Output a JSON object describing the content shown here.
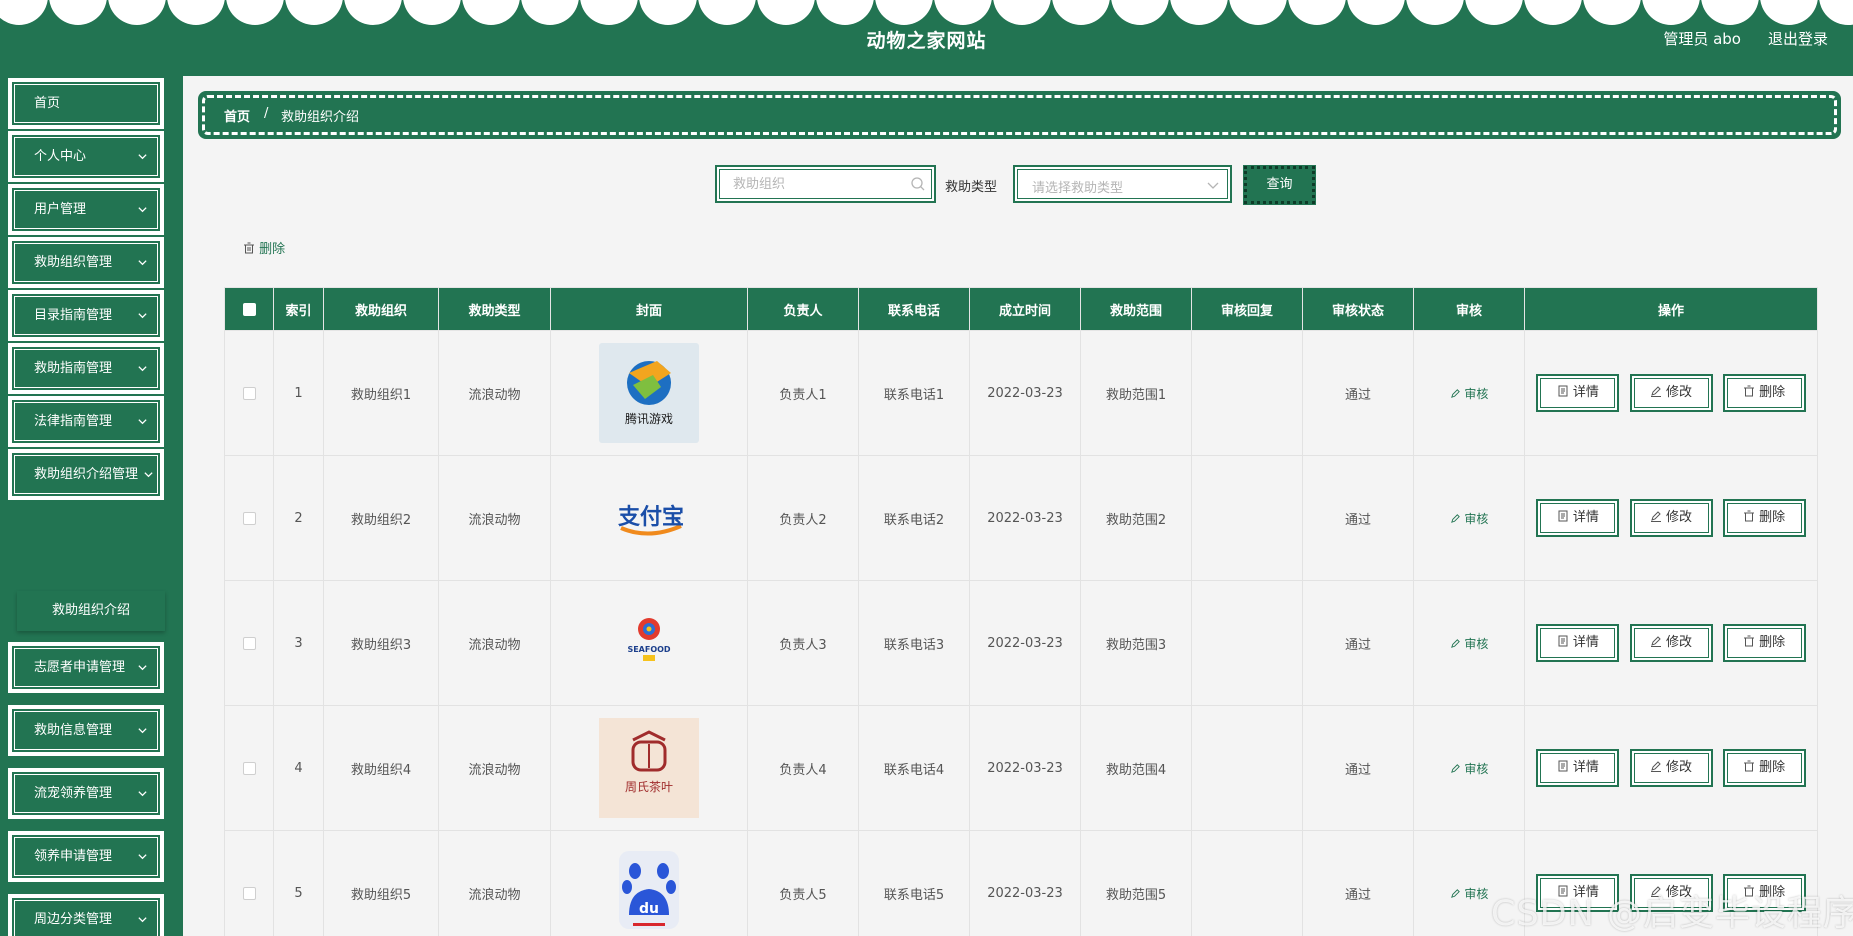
{
  "header": {
    "title": "动物之家网站",
    "user": "管理员 abo",
    "logout": "退出登录"
  },
  "colors": {
    "primary": "#227452",
    "background": "#f4f4f4",
    "link": "#227452"
  },
  "sidebar": {
    "items": [
      {
        "label": "首页"
      },
      {
        "label": "个人中心"
      },
      {
        "label": "用户管理"
      },
      {
        "label": "救助组织管理"
      },
      {
        "label": "目录指南管理"
      },
      {
        "label": "救助指南管理"
      },
      {
        "label": "法律指南管理"
      },
      {
        "label": "救助组织介绍管理"
      },
      {
        "label": "志愿者申请管理"
      },
      {
        "label": "救助信息管理"
      },
      {
        "label": "流宠领养管理"
      },
      {
        "label": "领养申请管理"
      },
      {
        "label": "周边分类管理"
      }
    ],
    "submenu_item": "救助组织介绍"
  },
  "breadcrumb": {
    "home": "首页",
    "separator": "/",
    "current": "救助组织介绍"
  },
  "search": {
    "org_placeholder": "救助组织",
    "type_label": "救助类型",
    "type_placeholder": "请选择救助类型",
    "query_button": "查询"
  },
  "toolbar": {
    "delete_label": "删除"
  },
  "table": {
    "headers": [
      "索引",
      "救助组织",
      "救助类型",
      "封面",
      "负责人",
      "联系电话",
      "成立时间",
      "救助范围",
      "审核回复",
      "审核状态",
      "审核",
      "操作"
    ],
    "audit_label": "审核",
    "actions": {
      "detail": "详情",
      "edit": "修改",
      "delete": "删除"
    },
    "rows": [
      {
        "index": "1",
        "org": "救助组织1",
        "type": "流浪动物",
        "cover_icon": "tencent-games-logo",
        "cover_text": "腾讯游戏",
        "owner": "负责人1",
        "phone": "联系电话1",
        "date": "2022-03-23",
        "scope": "救助范围1",
        "reply": "",
        "status": "通过"
      },
      {
        "index": "2",
        "org": "救助组织2",
        "type": "流浪动物",
        "cover_icon": "alipay-logo",
        "cover_text": "支付宝",
        "owner": "负责人2",
        "phone": "联系电话2",
        "date": "2022-03-23",
        "scope": "救助范围2",
        "reply": "",
        "status": "通过"
      },
      {
        "index": "3",
        "org": "救助组织3",
        "type": "流浪动物",
        "cover_icon": "seafood-logo",
        "cover_text": "SEAFOOD",
        "owner": "负责人3",
        "phone": "联系电话3",
        "date": "2022-03-23",
        "scope": "救助范围3",
        "reply": "",
        "status": "通过"
      },
      {
        "index": "4",
        "org": "救助组织4",
        "type": "流浪动物",
        "cover_icon": "tea-shop-logo",
        "cover_text": "周氏茶叶",
        "owner": "负责人4",
        "phone": "联系电话4",
        "date": "2022-03-23",
        "scope": "救助范围4",
        "reply": "",
        "status": "通过"
      },
      {
        "index": "5",
        "org": "救助组织5",
        "type": "流浪动物",
        "cover_icon": "baidu-logo",
        "cover_text": "du",
        "owner": "负责人5",
        "phone": "联系电话5",
        "date": "2022-03-23",
        "scope": "救助范围5",
        "reply": "",
        "status": "通过"
      }
    ]
  },
  "watermark": "CSDN @启变毕设程序"
}
